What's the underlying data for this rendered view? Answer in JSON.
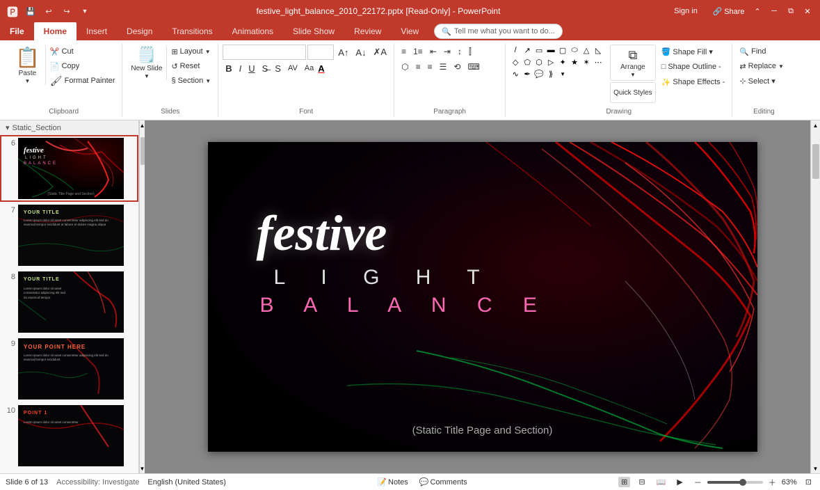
{
  "titlebar": {
    "title": "festive_light_balance_2010_22172.pptx [Read-Only] - PowerPoint",
    "mode": "[Read-Only]",
    "appname": "PowerPoint",
    "qat": [
      "save",
      "undo",
      "redo",
      "customize"
    ],
    "winbtns": [
      "minimize",
      "restore",
      "close"
    ]
  },
  "ribbon": {
    "tabs": [
      "File",
      "Home",
      "Insert",
      "Design",
      "Transitions",
      "Animations",
      "Slide Show",
      "Review",
      "View"
    ],
    "active_tab": "Home",
    "tell_me": "Tell me what you want to do...",
    "groups": {
      "clipboard": {
        "label": "Clipboard",
        "paste": "Paste",
        "cut": "Cut",
        "copy": "Copy",
        "format_painter": "Format Painter"
      },
      "slides": {
        "label": "Slides",
        "new_slide": "New Slide",
        "layout": "Layout",
        "reset": "Reset",
        "section": "Section"
      },
      "font": {
        "label": "Font",
        "font_name": "",
        "font_size": "",
        "bold": "B",
        "italic": "I",
        "underline": "U",
        "strikethrough": "S",
        "font_color": "A",
        "increase_size": "A+",
        "decrease_size": "A-"
      },
      "paragraph": {
        "label": "Paragraph",
        "bullets": "≡",
        "numbering": "≡1",
        "indent_less": "←",
        "indent_more": "→",
        "align_left": "≡",
        "align_center": "≡",
        "align_right": "≡",
        "justify": "≡"
      },
      "drawing": {
        "label": "Drawing",
        "arrange": "Arrange",
        "quick_styles": "Quick Styles",
        "shape_fill": "Shape Fill ▾",
        "shape_outline": "Shape Outline -",
        "shape_effects": "Shape Effects -"
      },
      "editing": {
        "label": "Editing",
        "find": "Find",
        "replace": "Replace",
        "select": "Select ▾"
      }
    }
  },
  "sidebar": {
    "section_name": "Static_Section",
    "slides": [
      {
        "number": "6",
        "active": true,
        "thumb": "festive"
      },
      {
        "number": "7",
        "active": false,
        "thumb": "content"
      },
      {
        "number": "8",
        "active": false,
        "thumb": "content2"
      },
      {
        "number": "9",
        "active": false,
        "thumb": "content3"
      },
      {
        "number": "10",
        "active": false,
        "thumb": "content4"
      }
    ]
  },
  "slide": {
    "festive_text": "festive",
    "light_text": "L I G H T",
    "balance_text": "B A L A N C E",
    "subtitle": "(Static Title Page and Section)"
  },
  "statusbar": {
    "slide_info": "Slide 6 of 13",
    "language": "English (United States)",
    "notes_label": "Notes",
    "comments_label": "Comments",
    "zoom_percent": "63%",
    "accessibility": "Accessibility: Investigate"
  }
}
